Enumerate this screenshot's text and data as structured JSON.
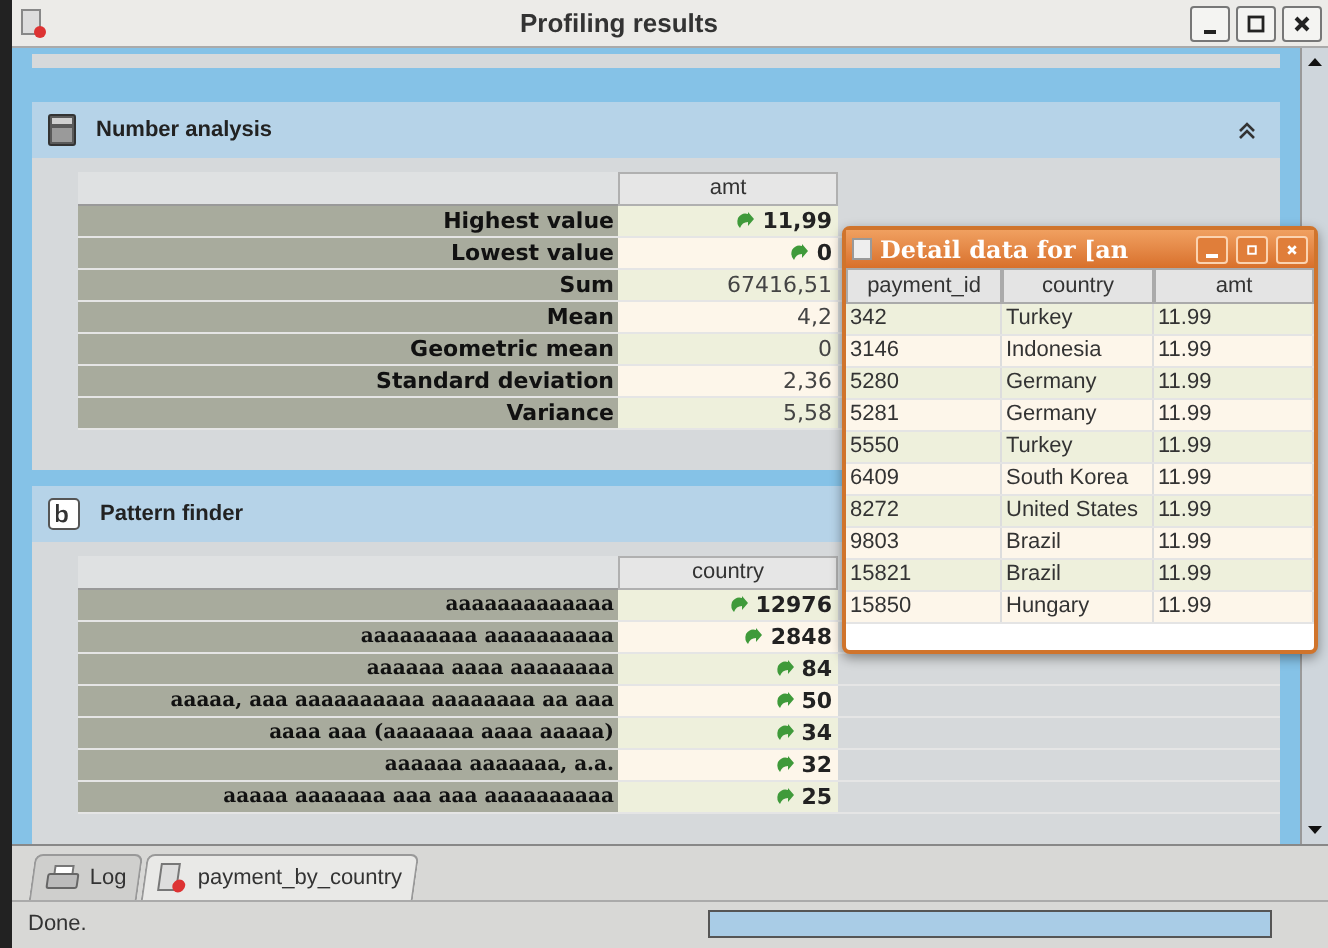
{
  "window": {
    "title": "Profiling results"
  },
  "sections": [
    {
      "title": "Number analysis",
      "kind": "numbers",
      "collapsible": true,
      "column": "amt",
      "rows": [
        {
          "label": "Highest value",
          "value": "11,99",
          "drill": true
        },
        {
          "label": "Lowest value",
          "value": "0",
          "drill": true
        },
        {
          "label": "Sum",
          "value": "67416,51",
          "drill": false
        },
        {
          "label": "Mean",
          "value": "4,2",
          "drill": false
        },
        {
          "label": "Geometric mean",
          "value": "0",
          "drill": false
        },
        {
          "label": "Standard deviation",
          "value": "2,36",
          "drill": false
        },
        {
          "label": "Variance",
          "value": "5,58",
          "drill": false
        }
      ]
    },
    {
      "title": "Pattern finder",
      "kind": "patterns",
      "collapsible": false,
      "column": "country",
      "rows": [
        {
          "label": "aaaaaaaaaaaaa",
          "value": "12976",
          "drill": true
        },
        {
          "label": "aaaaaaaaa aaaaaaaaaa",
          "value": "2848",
          "drill": true
        },
        {
          "label": "aaaaaa aaaa aaaaaaaa",
          "value": "84",
          "drill": true
        },
        {
          "label": "aaaaa, aaa aaaaaaaaaa aaaaaaaa aa aaa",
          "value": "50",
          "drill": true
        },
        {
          "label": "aaaa aaa (aaaaaaa aaaa aaaaa)",
          "value": "34",
          "drill": true
        },
        {
          "label": "aaaaaa aaaaaaa, a.a.",
          "value": "32",
          "drill": true
        },
        {
          "label": "aaaaa aaaaaaa aaa aaa aaaaaaaaaa",
          "value": "25",
          "drill": true
        }
      ]
    }
  ],
  "detail_window": {
    "title": "Detail data for [an",
    "columns": [
      "payment_id",
      "country",
      "amt"
    ],
    "rows": [
      [
        "342",
        "Turkey",
        "11.99"
      ],
      [
        "3146",
        "Indonesia",
        "11.99"
      ],
      [
        "5280",
        "Germany",
        "11.99"
      ],
      [
        "5281",
        "Germany",
        "11.99"
      ],
      [
        "5550",
        "Turkey",
        "11.99"
      ],
      [
        "6409",
        "South Korea",
        "11.99"
      ],
      [
        "8272",
        "United States",
        "11.99"
      ],
      [
        "9803",
        "Brazil",
        "11.99"
      ],
      [
        "15821",
        "Brazil",
        "11.99"
      ],
      [
        "15850",
        "Hungary",
        "11.99"
      ]
    ]
  },
  "tabs": [
    {
      "label": "Log",
      "selected": false
    },
    {
      "label": "payment_by_country",
      "selected": true
    }
  ],
  "status_bar": {
    "text": "Done.",
    "level": 1
  }
}
